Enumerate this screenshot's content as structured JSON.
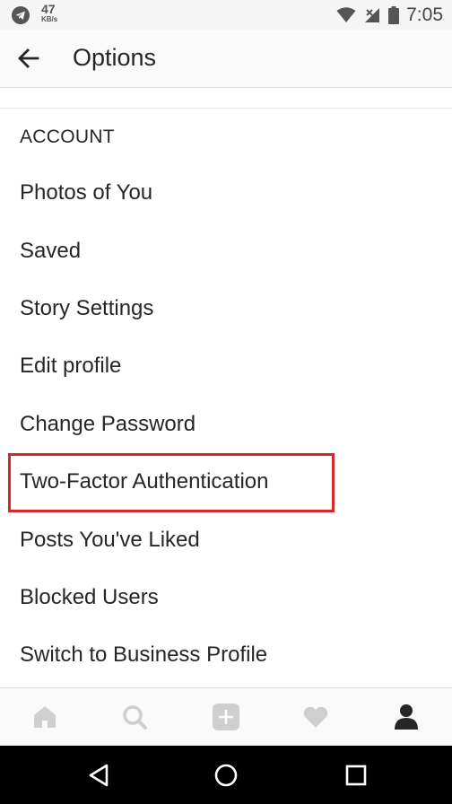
{
  "status_bar": {
    "net_speed": "47",
    "net_unit": "KB/s",
    "time": "7:05",
    "icons": [
      "telegram-icon",
      "wifi-icon",
      "signal-icon",
      "battery-icon"
    ]
  },
  "header": {
    "title": "Options",
    "back_icon": "arrow-left-icon"
  },
  "section": {
    "title": "ACCOUNT"
  },
  "items": [
    {
      "label": "Photos of You"
    },
    {
      "label": "Saved"
    },
    {
      "label": "Story Settings"
    },
    {
      "label": "Edit profile"
    },
    {
      "label": "Change Password"
    },
    {
      "label": "Two-Factor Authentication",
      "highlighted": true
    },
    {
      "label": "Posts You've Liked"
    },
    {
      "label": "Blocked Users"
    },
    {
      "label": "Switch to Business Profile"
    }
  ],
  "highlight_color": "#d4282d",
  "tab_bar": {
    "tabs": [
      "home-icon",
      "search-icon",
      "add-icon",
      "heart-icon",
      "profile-icon"
    ],
    "active": "profile-icon"
  },
  "nav_bar": {
    "buttons": [
      "back-triangle-icon",
      "home-circle-icon",
      "recents-square-icon"
    ]
  }
}
